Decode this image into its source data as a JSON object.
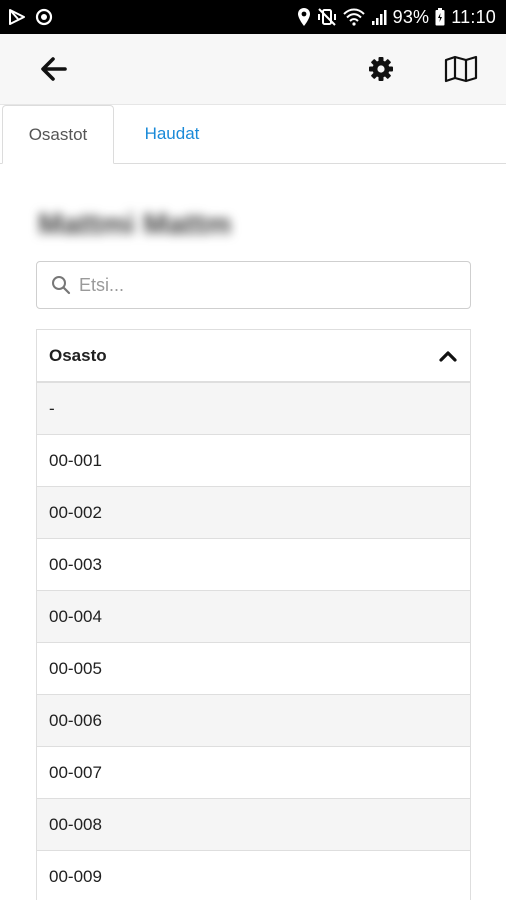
{
  "status_bar": {
    "battery": "93%",
    "time": "11:10",
    "left_icons": [
      "play-store-icon",
      "sync-icon"
    ],
    "right_icons": [
      "location-icon",
      "vibrate-mute-icon",
      "wifi-icon",
      "signal-icon",
      "battery-icon"
    ]
  },
  "appbar": {
    "back_icon": "arrow-left-icon",
    "settings_icon": "gear-icon",
    "map_icon": "map-icon"
  },
  "tabs": [
    {
      "label": "Osastot",
      "active": true
    },
    {
      "label": "Haudat",
      "active": false
    }
  ],
  "main": {
    "blurred_title": "Mattmi Mattm",
    "search": {
      "value": "",
      "placeholder": "Etsi..."
    },
    "table": {
      "header": "Osasto",
      "sort_icon": "chevron-up-icon",
      "rows": [
        "-",
        "00-001",
        "00-002",
        "00-003",
        "00-004",
        "00-005",
        "00-006",
        "00-007",
        "00-008",
        "00-009"
      ]
    }
  },
  "colors": {
    "accent": "#1a8ad8",
    "status_bar": "#000000",
    "appbar_bg": "#f7f7f7",
    "row_stripe": "#f5f5f5"
  }
}
